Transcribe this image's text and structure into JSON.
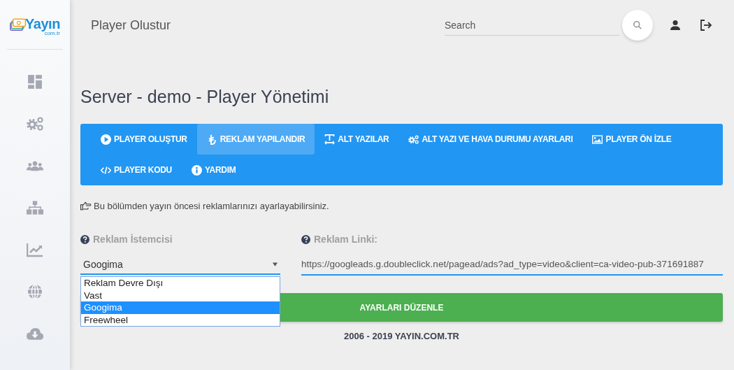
{
  "logo": {
    "name": "Yayın",
    "suffix": "com.tr"
  },
  "header": {
    "title": "Player Olustur",
    "search": {
      "placeholder": "Search"
    }
  },
  "page_title": "Server - demo - Player Yönetimi",
  "tabs": [
    {
      "label": "PLAYER OLUŞTUR",
      "selected": false
    },
    {
      "label": "REKLAM YAPILANDIR",
      "selected": true
    },
    {
      "label": "ALT YAZILAR",
      "selected": false
    },
    {
      "label": "ALT YAZI VE HAVA DURUMU AYARLARI",
      "selected": false
    },
    {
      "label": "PLAYER ÖN İZLE",
      "selected": false
    },
    {
      "label": "PLAYER KODU",
      "selected": false
    },
    {
      "label": "YARDIM",
      "selected": false
    }
  ],
  "hint": "Bu bölümden yayın öncesi reklamlarınızı ayarlayabilirsiniz.",
  "ad_client": {
    "label": "Reklam İstemcisi",
    "value": "Googima",
    "expanded": true,
    "options": [
      {
        "label": "Reklam Devre Dışı",
        "selected": false
      },
      {
        "label": "Vast",
        "selected": false
      },
      {
        "label": "Googima",
        "selected": true
      },
      {
        "label": "Freewheel",
        "selected": false
      }
    ]
  },
  "ad_link": {
    "label": "Reklam Linki:",
    "value": "https://googleads.g.doubleclick.net/pagead/ads?ad_type=video&client=ca-video-pub-371691887"
  },
  "save_button": "AYARLARI DÜZENLE",
  "footer": "2006 - 2019 YAYIN.COM.TR"
}
